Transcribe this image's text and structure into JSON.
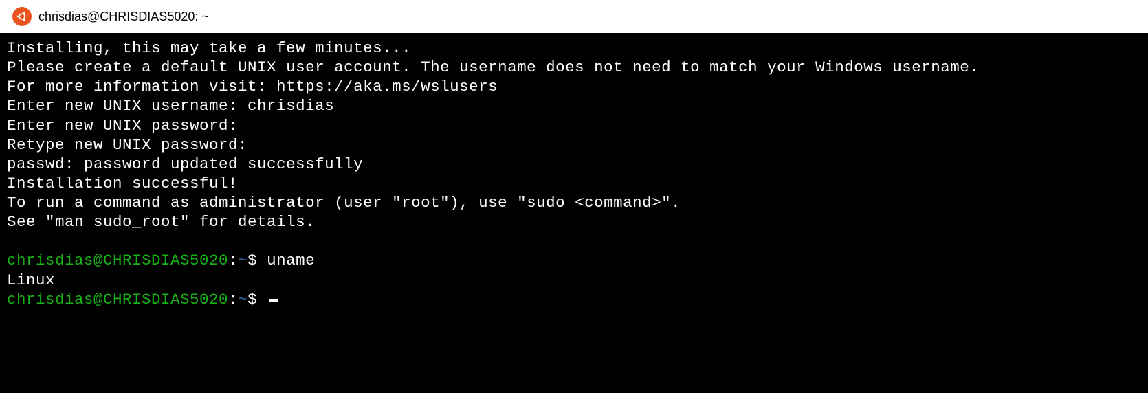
{
  "titlebar": {
    "icon": "ubuntu-icon",
    "title": "chrisdias@CHRISDIAS5020: ~"
  },
  "terminal": {
    "lines": [
      "Installing, this may take a few minutes...",
      "Please create a default UNIX user account. The username does not need to match your Windows username.",
      "For more information visit: https://aka.ms/wslusers",
      "Enter new UNIX username: chrisdias",
      "Enter new UNIX password:",
      "Retype new UNIX password:",
      "passwd: password updated successfully",
      "Installation successful!",
      "To run a command as administrator (user \"root\"), use \"sudo <command>\".",
      "See \"man sudo_root\" for details."
    ],
    "prompt1": {
      "userhost": "chrisdias@CHRISDIAS5020",
      "colon": ":",
      "path": "~",
      "dollar": "$",
      "command": " uname"
    },
    "output1": "Linux",
    "prompt2": {
      "userhost": "chrisdias@CHRISDIAS5020",
      "colon": ":",
      "path": "~",
      "dollar": "$",
      "command": " "
    }
  }
}
